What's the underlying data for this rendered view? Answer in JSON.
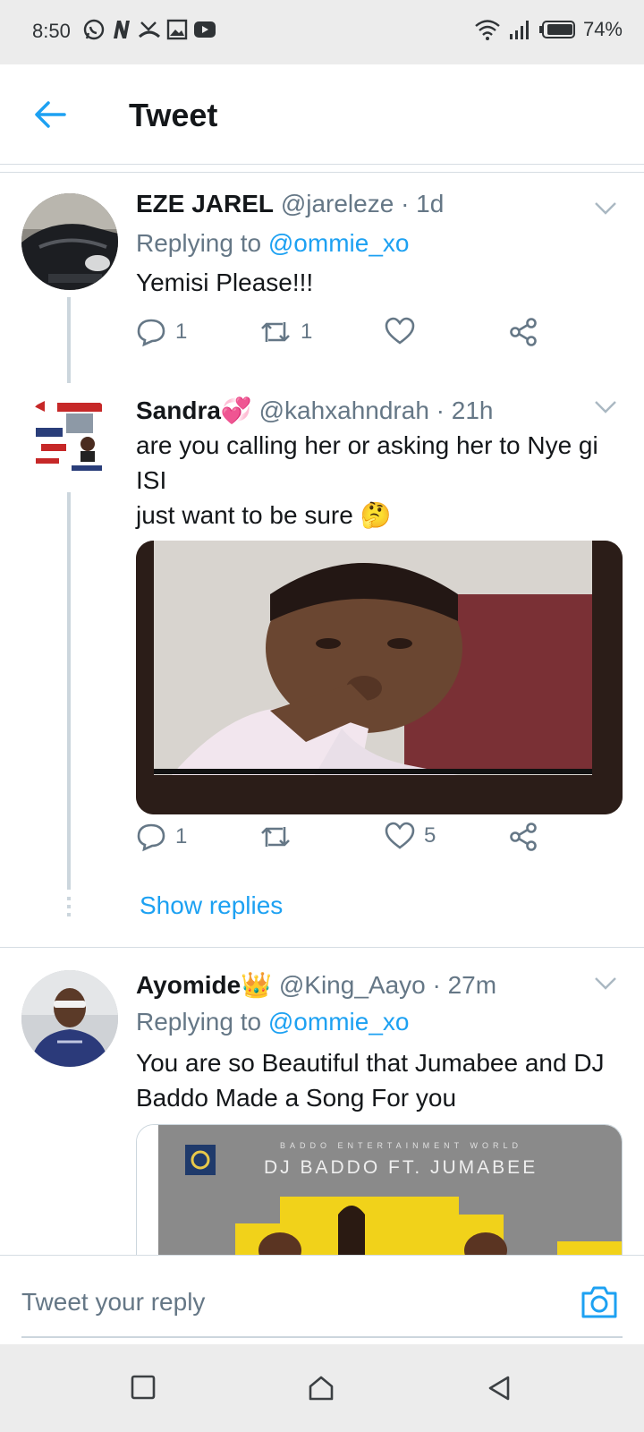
{
  "status_bar": {
    "time": "8:50",
    "battery": "74%",
    "notification_icons": [
      "whatsapp-icon",
      "n-app-icon",
      "missed-call-icon",
      "gallery-icon",
      "youtube-icon"
    ],
    "system_icons": [
      "wifi-icon",
      "signal-icon",
      "battery-icon"
    ]
  },
  "app_bar": {
    "title": "Tweet",
    "back_icon": "arrow-left-icon"
  },
  "tweets": [
    {
      "name": "EZE JAREL",
      "handle": "@jareleze · 1d",
      "replying_prefix": "Replying to",
      "replying_to": "@ommie_xo",
      "text": "Yemisi Please!!!",
      "replies": "1",
      "retweets": "1",
      "likes": ""
    },
    {
      "name": "Sandra💞",
      "handle": "@kahxahndrah · 21h",
      "text_line1": "are you calling her or asking her to Nye gi ISI",
      "text_line2": "just want to be sure 🤔",
      "replies": "1",
      "retweets": "",
      "likes": "5",
      "show_replies": "Show replies"
    },
    {
      "name": "Ayomide👑",
      "handle": "@King_Aayo · 27m",
      "replying_prefix": "Replying to",
      "replying_to": "@ommie_xo",
      "text": "You are so Beautiful that Jumabee and DJ Baddo Made a Song For you",
      "media_small": "BADDO ENTERTAINMENT WORLD",
      "media_title": "DJ BADDO FT. JUMABEE"
    }
  ],
  "reply_bar": {
    "placeholder": "Tweet your reply",
    "camera_icon": "camera-icon"
  },
  "colors": {
    "accent": "#1da1f2",
    "secondary_text": "#657786",
    "divider": "#d6dde3"
  }
}
